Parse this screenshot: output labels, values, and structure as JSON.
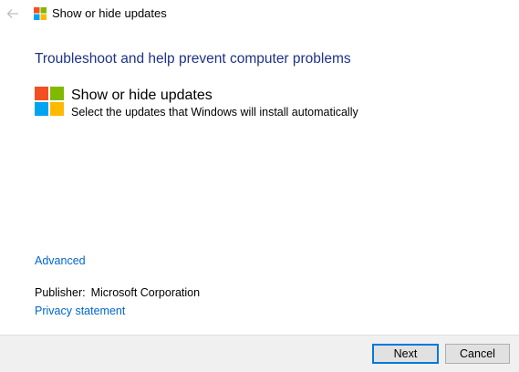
{
  "window": {
    "title": "Show or hide updates",
    "back_icon": "back-arrow-icon",
    "logo_icon": "windows-logo-icon"
  },
  "content": {
    "heading": "Troubleshoot and help prevent computer problems",
    "tool": {
      "icon": "windows-logo-icon",
      "title": "Show or hide updates",
      "description": "Select the updates that Windows will install automatically"
    },
    "advanced_link": "Advanced",
    "publisher_label": "Publisher:",
    "publisher_value": "Microsoft Corporation",
    "privacy_link": "Privacy statement"
  },
  "footer": {
    "next_label": "Next",
    "cancel_label": "Cancel"
  },
  "colors": {
    "heading": "#1e3287",
    "link": "#0066cc",
    "footer_bg": "#f0f0f0",
    "default_button_border": "#0078d7",
    "logo_red": "#f25022",
    "logo_green": "#7fba00",
    "logo_blue": "#00a4ef",
    "logo_yellow": "#ffb900"
  }
}
